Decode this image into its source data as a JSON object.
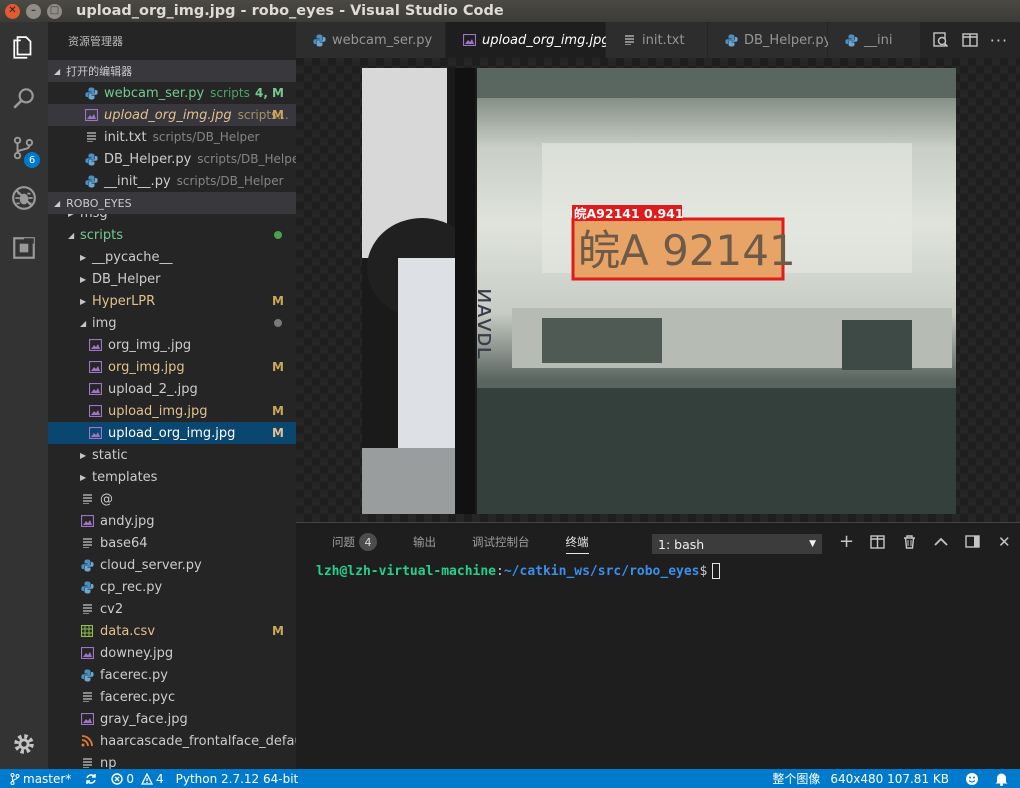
{
  "window": {
    "title": "upload_org_img.jpg - robo_eyes - Visual Studio Code"
  },
  "activitybar": {
    "scm_badge": "6"
  },
  "sidebar": {
    "title": "资源管理器",
    "open_editors_header": "打开的编辑器",
    "open_editors": [
      {
        "name": "webcam_ser.py",
        "desc": "scripts",
        "status": "4, M",
        "type": "py",
        "color": "green"
      },
      {
        "name": "upload_org_img.jpg",
        "desc": "scripts...",
        "status": "M",
        "type": "img",
        "color": "mod"
      },
      {
        "name": "init.txt",
        "desc": "scripts/DB_Helper",
        "status": "",
        "type": "txt",
        "color": "norm"
      },
      {
        "name": "DB_Helper.py",
        "desc": "scripts/DB_Helper",
        "status": "",
        "type": "py",
        "color": "norm"
      },
      {
        "name": "__init__.py",
        "desc": "scripts/DB_Helper",
        "status": "",
        "type": "py",
        "color": "norm"
      }
    ],
    "project_header": "ROBO_EYES",
    "tree_partial": "msg",
    "tree": [
      {
        "name": "scripts",
        "indent": 1,
        "kind": "folder-open",
        "color": "green",
        "status": "",
        "dot": "#4ea051"
      },
      {
        "name": "__pycache__",
        "indent": 2,
        "kind": "folder",
        "color": "norm",
        "status": ""
      },
      {
        "name": "DB_Helper",
        "indent": 2,
        "kind": "folder",
        "color": "norm",
        "status": ""
      },
      {
        "name": "HyperLPR",
        "indent": 2,
        "kind": "folder",
        "color": "mod",
        "status": "M"
      },
      {
        "name": "img",
        "indent": 2,
        "kind": "folder-open",
        "color": "norm",
        "status": "",
        "dot": "#7a7a7a"
      },
      {
        "name": "org_img_.jpg",
        "indent": 3,
        "kind": "img",
        "color": "norm",
        "status": ""
      },
      {
        "name": "org_img.jpg",
        "indent": 3,
        "kind": "img",
        "color": "mod",
        "status": "M"
      },
      {
        "name": "upload_2_.jpg",
        "indent": 3,
        "kind": "img",
        "color": "norm",
        "status": ""
      },
      {
        "name": "upload_img.jpg",
        "indent": 3,
        "kind": "img",
        "color": "mod",
        "status": "M"
      },
      {
        "name": "upload_org_img.jpg",
        "indent": 3,
        "kind": "img",
        "color": "active",
        "status": "M",
        "active": true
      },
      {
        "name": "static",
        "indent": 2,
        "kind": "folder",
        "color": "norm",
        "status": ""
      },
      {
        "name": "templates",
        "indent": 2,
        "kind": "folder",
        "color": "norm",
        "status": ""
      },
      {
        "name": "@",
        "indent": 2,
        "kind": "txt",
        "color": "norm",
        "status": ""
      },
      {
        "name": "andy.jpg",
        "indent": 2,
        "kind": "img",
        "color": "norm",
        "status": ""
      },
      {
        "name": "base64",
        "indent": 2,
        "kind": "txt",
        "color": "norm",
        "status": ""
      },
      {
        "name": "cloud_server.py",
        "indent": 2,
        "kind": "py",
        "color": "norm",
        "status": ""
      },
      {
        "name": "cp_rec.py",
        "indent": 2,
        "kind": "py",
        "color": "norm",
        "status": ""
      },
      {
        "name": "cv2",
        "indent": 2,
        "kind": "txt",
        "color": "norm",
        "status": ""
      },
      {
        "name": "data.csv",
        "indent": 2,
        "kind": "csv",
        "color": "mod",
        "status": "M"
      },
      {
        "name": "downey.jpg",
        "indent": 2,
        "kind": "img",
        "color": "norm",
        "status": ""
      },
      {
        "name": "facerec.py",
        "indent": 2,
        "kind": "py",
        "color": "norm",
        "status": ""
      },
      {
        "name": "facerec.pyc",
        "indent": 2,
        "kind": "txt",
        "color": "norm",
        "status": ""
      },
      {
        "name": "gray_face.jpg",
        "indent": 2,
        "kind": "img",
        "color": "norm",
        "status": ""
      },
      {
        "name": "haarcascade_frontalface_default...",
        "indent": 2,
        "kind": "rss",
        "color": "norm",
        "status": ""
      },
      {
        "name": "np",
        "indent": 2,
        "kind": "txt",
        "color": "norm",
        "status": ""
      }
    ]
  },
  "tabs": [
    {
      "name": "webcam_ser.py",
      "type": "py",
      "active": false
    },
    {
      "name": "upload_org_img.jpg",
      "type": "img",
      "active": true
    },
    {
      "name": "init.txt",
      "type": "txt",
      "active": false
    },
    {
      "name": "DB_Helper.py",
      "type": "py",
      "active": false
    },
    {
      "name": "__ini",
      "type": "py",
      "active": false
    }
  ],
  "image": {
    "plate_label": "皖A92141 0.941",
    "plate_text": "皖A 92141",
    "sign_text": "ᴎᴀᴠᴅʟ"
  },
  "panel": {
    "tabs": [
      "问题",
      "输出",
      "调试控制台",
      "终端"
    ],
    "problems_count": "4",
    "terminal_select": "1: bash",
    "prompt_user": "lzh@lzh-virtual-machine",
    "prompt_sep": ":",
    "prompt_path": "~/catkin_ws/src/robo_eyes",
    "prompt_end": "$"
  },
  "statusbar": {
    "branch": "master*",
    "errors": "0",
    "warnings": "4",
    "interpreter": "Python 2.7.12 64-bit",
    "image_mode": "整个图像",
    "image_info": "640x480 107.81 KB"
  }
}
